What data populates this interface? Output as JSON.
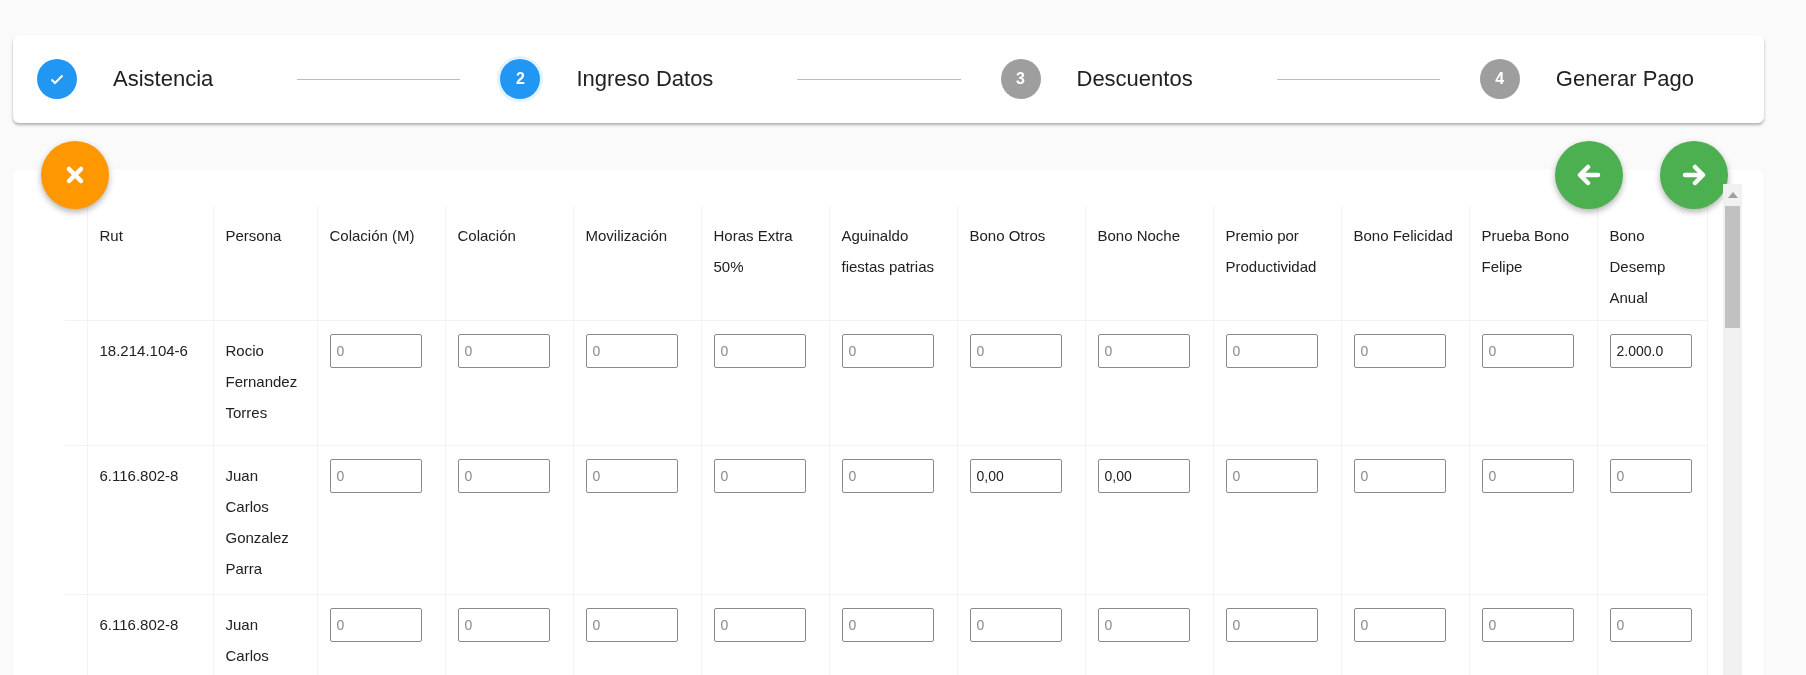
{
  "stepper": {
    "steps": [
      {
        "label": "Asistencia",
        "completed": true,
        "selected": false
      },
      {
        "label": "Ingreso Datos",
        "number": "2",
        "completed": false,
        "selected": true
      },
      {
        "label": "Descuentos",
        "number": "3",
        "completed": false,
        "selected": false
      },
      {
        "label": "Generar Pago",
        "number": "4",
        "completed": false,
        "selected": false
      }
    ]
  },
  "actions": [
    {
      "kind": "close"
    },
    {
      "kind": "back"
    },
    {
      "kind": "next"
    }
  ],
  "table": {
    "columns": [
      "Rut",
      "Persona",
      "Colación (M)",
      "Colación",
      "Movilización",
      "Horas Extra 50%",
      "Aguinaldo fiestas patrias",
      "Bono Otros",
      "Bono Noche",
      "Premio por Productividad",
      "Bono Felicidad",
      "Prueba Bono Felipe",
      "Bono Desemp Anual"
    ],
    "rows": [
      {
        "rut": "18.214.104-6",
        "persona": "Rocio Fernandez Torres",
        "inputs": [
          {
            "placeholder": "0"
          },
          {
            "placeholder": "0"
          },
          {
            "placeholder": "0"
          },
          {
            "placeholder": "0"
          },
          {
            "placeholder": "0"
          },
          {
            "placeholder": "0"
          },
          {
            "placeholder": "0"
          },
          {
            "placeholder": "0"
          },
          {
            "placeholder": "0"
          },
          {
            "placeholder": "0"
          },
          {
            "value": "2.000.0"
          }
        ]
      },
      {
        "rut": "6.116.802-8",
        "persona": "Juan Carlos Gonzalez Parra",
        "inputs": [
          {
            "placeholder": "0"
          },
          {
            "placeholder": "0"
          },
          {
            "placeholder": "0"
          },
          {
            "placeholder": "0"
          },
          {
            "placeholder": "0"
          },
          {
            "value": "0,00"
          },
          {
            "value": "0,00"
          },
          {
            "placeholder": "0"
          },
          {
            "placeholder": "0"
          },
          {
            "placeholder": "0"
          },
          {
            "placeholder": "0"
          }
        ]
      },
      {
        "rut": "6.116.802-8",
        "persona": "Juan Carlos",
        "inputs": [
          {
            "placeholder": "0"
          },
          {
            "placeholder": "0"
          },
          {
            "placeholder": "0"
          },
          {
            "placeholder": "0"
          },
          {
            "placeholder": "0"
          },
          {
            "placeholder": "0"
          },
          {
            "placeholder": "0"
          },
          {
            "placeholder": "0"
          },
          {
            "placeholder": "0"
          },
          {
            "placeholder": "0"
          },
          {
            "placeholder": "0"
          }
        ]
      }
    ]
  }
}
